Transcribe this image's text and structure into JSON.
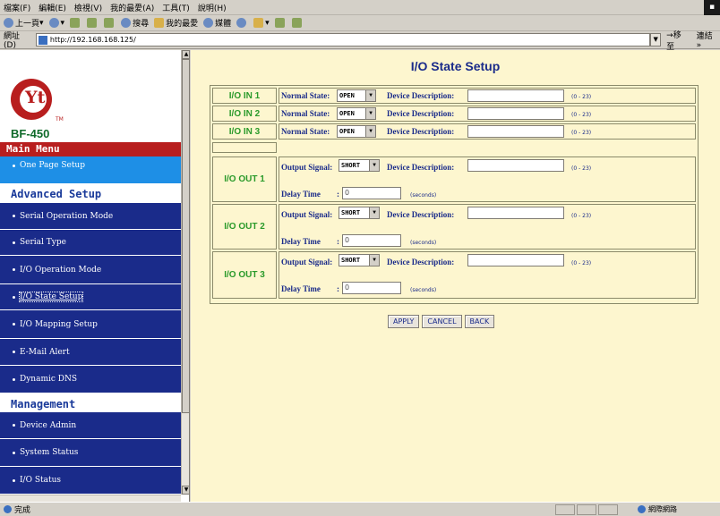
{
  "browser": {
    "menu": [
      "檔案(F)",
      "編輯(E)",
      "檢視(V)",
      "我的最愛(A)",
      "工具(T)",
      "說明(H)"
    ],
    "toolbar": [
      "上一頁",
      "搜尋",
      "我的最愛",
      "媒體"
    ],
    "address_label": "網址(D)",
    "address_url": "http://192.168.168.125/",
    "go_label": "移至",
    "links_label": "連結",
    "status_text": "完成",
    "zone_text": "網際網路"
  },
  "sidebar": {
    "logo_text": "Yt",
    "logo_tm": "TM",
    "model": "BF-450",
    "main_menu": "Main Menu",
    "main_items": [
      {
        "label": "One Page Setup"
      }
    ],
    "advanced_title": "Advanced Setup",
    "advanced_items": [
      {
        "label": "Serial Operation Mode"
      },
      {
        "label": "Serial Type"
      },
      {
        "label": "I/O Operation Mode"
      },
      {
        "label": "I/O State Setup"
      },
      {
        "label": "I/O Mapping Setup"
      },
      {
        "label": "E-Mail Alert"
      },
      {
        "label": "Dynamic DNS"
      }
    ],
    "management_title": "Management",
    "management_items": [
      {
        "label": "Device Admin"
      },
      {
        "label": "System Status"
      },
      {
        "label": "I/O Status"
      }
    ]
  },
  "main": {
    "title": "I/O State Setup",
    "labels": {
      "normal_state": "Normal State:",
      "output_signal": "Output Signal:",
      "device_description": "Device Description:",
      "delay_time": "Delay Time",
      "delay_colon": ":",
      "hint_range": "(0 - 23)",
      "hint_seconds": "(seconds)"
    },
    "inputs": [
      {
        "name": "I/O IN 1",
        "state": "OPEN",
        "description": ""
      },
      {
        "name": "I/O IN 2",
        "state": "OPEN",
        "description": ""
      },
      {
        "name": "I/O IN 3",
        "state": "OPEN",
        "description": ""
      }
    ],
    "outputs": [
      {
        "name": "I/O OUT 1",
        "signal": "SHORT",
        "description": "",
        "delay": "0"
      },
      {
        "name": "I/O OUT 2",
        "signal": "SHORT",
        "description": "",
        "delay": "0"
      },
      {
        "name": "I/O OUT 3",
        "signal": "SHORT",
        "description": "",
        "delay": "0"
      }
    ],
    "buttons": {
      "apply": "APPLY",
      "cancel": "CANCEL",
      "back": "BACK"
    }
  }
}
